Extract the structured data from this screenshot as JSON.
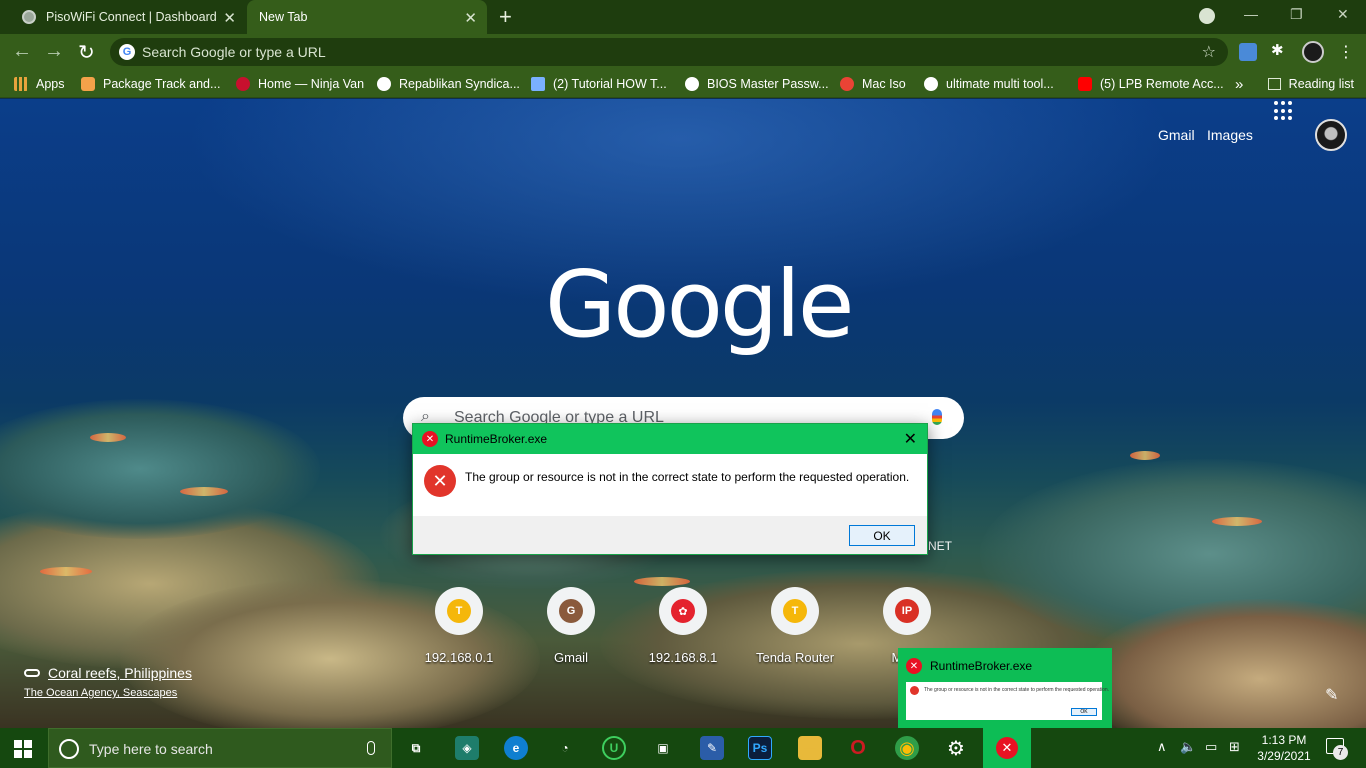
{
  "browser": {
    "tabs": [
      {
        "title": "PisoWiFi Connect | Dashboard"
      },
      {
        "title": "New Tab"
      }
    ],
    "new_tab_symbol": "+",
    "close_symbol": "✕",
    "window_controls": {
      "minimize": "—",
      "restore": "❐",
      "close": "✕"
    },
    "omnibox_placeholder": "Search Google or type a URL",
    "omnibox_favicon_letter": "G"
  },
  "bookmarks": {
    "items": [
      {
        "label": "Apps",
        "icon": "apps-grid-icon",
        "color": "#e8a33d"
      },
      {
        "label": "Package Track and...",
        "icon": "package-icon",
        "color": "#f4a24a"
      },
      {
        "label": "Home — Ninja Van",
        "icon": "ninja-van-icon",
        "color": "#c8102e"
      },
      {
        "label": "Repablikan Syndica...",
        "icon": "globe-icon",
        "color": "#ffffff"
      },
      {
        "label": "(2) Tutorial HOW T...",
        "icon": "cube-icon",
        "color": "#7ab0ff"
      },
      {
        "label": "BIOS Master Passw...",
        "icon": "globe-icon",
        "color": "#ffffff"
      },
      {
        "label": "Mac Iso",
        "icon": "gmail-icon",
        "color": "#ea4335"
      },
      {
        "label": "ultimate multi tool...",
        "icon": "google-icon",
        "color": "#ffffff"
      },
      {
        "label": "(5) LPB Remote Acc...",
        "icon": "youtube-icon",
        "color": "#ff0000"
      }
    ],
    "overflow": "»",
    "reading_list": "Reading list"
  },
  "ntp": {
    "gmail": "Gmail",
    "images": "Images",
    "logo": "Google",
    "search_placeholder": "Search Google or type a URL",
    "shortcuts": [
      {
        "label": "192.168.0.1",
        "letter": "T",
        "color": "#f5b70a"
      },
      {
        "label": "Gmail",
        "letter": "G",
        "color": "#8a5a3c"
      },
      {
        "label": "192.168.8.1",
        "letter": "✿",
        "color": "#e4232e"
      },
      {
        "label": "Tenda Router",
        "letter": "T",
        "color": "#f5b70a"
      },
      {
        "label": "Mobil",
        "letter": "IP",
        "color": "#d93025"
      }
    ],
    "ghost_text": "NET",
    "attribution_title": "Coral reefs, Philippines",
    "attribution_credit": "The Ocean Agency, Seascapes"
  },
  "dialog": {
    "title": "RuntimeBroker.exe",
    "message": "The group or resource is not in the correct state to perform the requested operation.",
    "ok_label": "OK",
    "icon_symbol": "✕",
    "title_bar_color": "#10c45c"
  },
  "preview": {
    "title": "RuntimeBroker.exe",
    "message": "The group or resource is not in the correct state to perform the requested operation.",
    "ok_label": "OK"
  },
  "taskbar": {
    "search_placeholder": "Type here to search",
    "pinned": [
      {
        "name": "task-view",
        "glyph": "⧉",
        "color": "#15480f"
      },
      {
        "name": "widget",
        "glyph": "◈",
        "color": "#1e7d6b"
      },
      {
        "name": "edge",
        "glyph": "e",
        "color": "#0f7fd0"
      },
      {
        "name": "speedtest",
        "glyph": "◔",
        "color": "#15480f"
      },
      {
        "name": "utorrent",
        "glyph": "U",
        "color": "#15480f"
      },
      {
        "name": "store",
        "glyph": "▣",
        "color": "#15480f"
      },
      {
        "name": "pen",
        "glyph": "✎",
        "color": "#2b5da8"
      },
      {
        "name": "photoshop",
        "glyph": "Ps",
        "color": "#0b1e3d"
      },
      {
        "name": "explorer",
        "glyph": "▬",
        "color": "#e8b93a"
      },
      {
        "name": "opera",
        "glyph": "O",
        "color": "#cc1b22"
      },
      {
        "name": "chrome",
        "glyph": "◉",
        "color": "#2f9d48"
      },
      {
        "name": "settings",
        "glyph": "⚙",
        "color": "#15480f"
      }
    ],
    "tray": {
      "chevron": "∧",
      "volume": "🔈",
      "network": "▭",
      "ime": "⊞"
    },
    "time": "1:13 PM",
    "date": "3/29/2021",
    "notifications": "7"
  }
}
